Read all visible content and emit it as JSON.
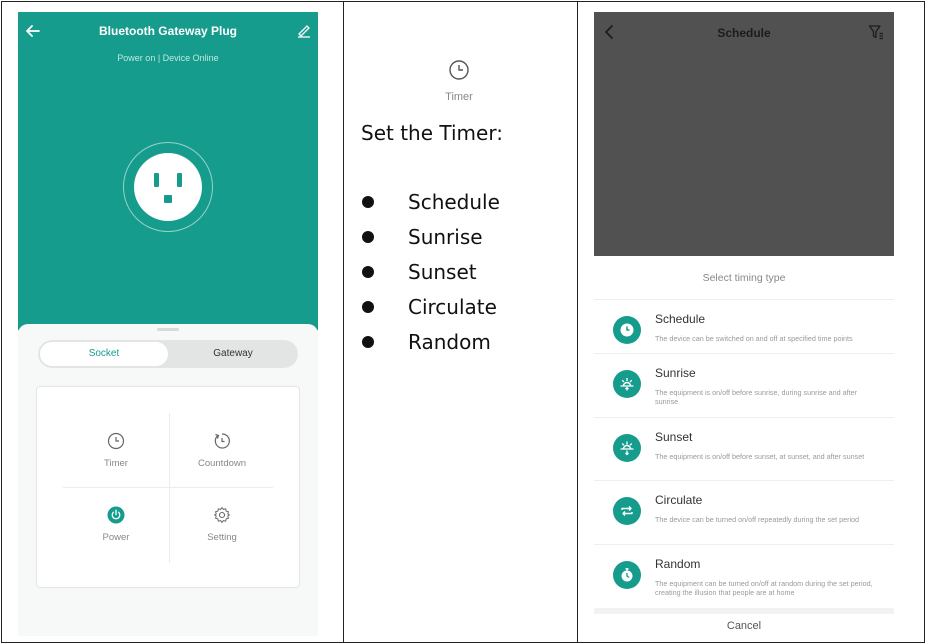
{
  "left_phone": {
    "title": "Bluetooth Gateway Plug",
    "status": "Power on | Device Online",
    "tabs": {
      "active": "Socket",
      "inactive": "Gateway"
    },
    "grid": [
      {
        "icon": "clock-icon",
        "label": "Timer"
      },
      {
        "icon": "countdown-icon",
        "label": "Countdown"
      },
      {
        "icon": "power-icon",
        "label": "Power"
      },
      {
        "icon": "gear-icon",
        "label": "Setting"
      }
    ]
  },
  "middle": {
    "icon_label": "Timer",
    "heading": "Set the Timer:",
    "bullets": [
      "Schedule",
      "Sunrise",
      "Sunset",
      "Circulate",
      "Random"
    ]
  },
  "right_phone": {
    "title": "Schedule",
    "sheet_title": "Select timing type",
    "options": [
      {
        "icon": "clock-icon",
        "title": "Schedule",
        "desc": "The device can be switched on and off at specified time points"
      },
      {
        "icon": "sunrise-icon",
        "title": "Sunrise",
        "desc": "The equipment is on/off before sunrise, during sunrise and after sunrise"
      },
      {
        "icon": "sunset-icon",
        "title": "Sunset",
        "desc": "The equipment is on/off before sunset, at sunset, and after sunset"
      },
      {
        "icon": "circulate-icon",
        "title": "Circulate",
        "desc": "The device can be turned on/off repeatedly during the set period"
      },
      {
        "icon": "random-icon",
        "title": "Random",
        "desc": "The equipment can be turned on/off at random during the set period, creating the illusion that people are at home"
      }
    ],
    "cancel_label": "Cancel"
  },
  "colors": {
    "accent": "#169c8c",
    "overlay": "#515151"
  }
}
